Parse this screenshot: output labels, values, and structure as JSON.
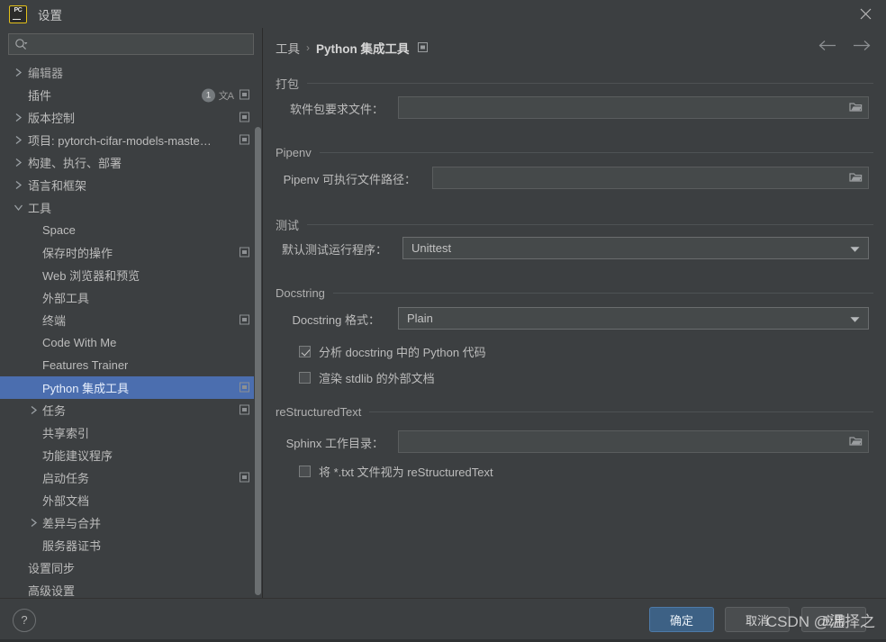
{
  "window": {
    "title": "设置",
    "logo_text": "PC",
    "close_label": "✕"
  },
  "search": {
    "value": "",
    "placeholder": ""
  },
  "sidebar": {
    "items": [
      {
        "label": "编辑器",
        "depth": 0,
        "arrow": "collapsed",
        "selected": false,
        "icons": []
      },
      {
        "label": "插件",
        "depth": 0,
        "arrow": "none",
        "selected": false,
        "icons": [
          "badge-1",
          "translate",
          "copy"
        ],
        "badge": "1"
      },
      {
        "label": "版本控制",
        "depth": 0,
        "arrow": "collapsed",
        "selected": false,
        "icons": [
          "copy"
        ]
      },
      {
        "label": "项目: pytorch-cifar-models-maste…",
        "depth": 0,
        "arrow": "collapsed",
        "selected": false,
        "icons": [
          "copy"
        ]
      },
      {
        "label": "构建、执行、部署",
        "depth": 0,
        "arrow": "collapsed",
        "selected": false,
        "icons": []
      },
      {
        "label": "语言和框架",
        "depth": 0,
        "arrow": "collapsed",
        "selected": false,
        "icons": []
      },
      {
        "label": "工具",
        "depth": 0,
        "arrow": "expanded",
        "selected": false,
        "icons": []
      },
      {
        "label": "Space",
        "depth": 1,
        "arrow": "none",
        "selected": false,
        "icons": []
      },
      {
        "label": "保存时的操作",
        "depth": 1,
        "arrow": "none",
        "selected": false,
        "icons": [
          "copy"
        ]
      },
      {
        "label": "Web 浏览器和预览",
        "depth": 1,
        "arrow": "none",
        "selected": false,
        "icons": []
      },
      {
        "label": "外部工具",
        "depth": 1,
        "arrow": "none",
        "selected": false,
        "icons": []
      },
      {
        "label": "终端",
        "depth": 1,
        "arrow": "none",
        "selected": false,
        "icons": [
          "copy"
        ]
      },
      {
        "label": "Code With Me",
        "depth": 1,
        "arrow": "none",
        "selected": false,
        "icons": []
      },
      {
        "label": "Features Trainer",
        "depth": 1,
        "arrow": "none",
        "selected": false,
        "icons": []
      },
      {
        "label": "Python 集成工具",
        "depth": 1,
        "arrow": "none",
        "selected": true,
        "icons": [
          "copy"
        ]
      },
      {
        "label": "任务",
        "depth": 1,
        "arrow": "collapsed",
        "selected": false,
        "icons": [
          "copy"
        ]
      },
      {
        "label": "共享索引",
        "depth": 1,
        "arrow": "none",
        "selected": false,
        "icons": []
      },
      {
        "label": "功能建议程序",
        "depth": 1,
        "arrow": "none",
        "selected": false,
        "icons": []
      },
      {
        "label": "启动任务",
        "depth": 1,
        "arrow": "none",
        "selected": false,
        "icons": [
          "copy"
        ]
      },
      {
        "label": "外部文档",
        "depth": 1,
        "arrow": "none",
        "selected": false,
        "icons": []
      },
      {
        "label": "差异与合并",
        "depth": 1,
        "arrow": "collapsed",
        "selected": false,
        "icons": []
      },
      {
        "label": "服务器证书",
        "depth": 1,
        "arrow": "none",
        "selected": false,
        "icons": []
      },
      {
        "label": "设置同步",
        "depth": 0,
        "arrow": "none",
        "selected": false,
        "icons": []
      },
      {
        "label": "高级设置",
        "depth": 0,
        "arrow": "none",
        "selected": false,
        "icons": []
      }
    ]
  },
  "breadcrumb": {
    "parent": "工具",
    "separator": "›",
    "current": "Python 集成工具"
  },
  "sections": {
    "packaging": {
      "title": "打包",
      "requirements_label": "软件包要求文件：",
      "requirements_value": ""
    },
    "pipenv": {
      "title": "Pipenv",
      "executable_label": "Pipenv 可执行文件路径：",
      "executable_value": ""
    },
    "testing": {
      "title": "测试",
      "default_runner_label": "默认测试运行程序：",
      "default_runner_value": "Unittest"
    },
    "docstring": {
      "title": "Docstring",
      "format_label": "Docstring 格式：",
      "format_value": "Plain",
      "analyze_label": "分析 docstring 中的 Python 代码",
      "analyze_checked": true,
      "render_stdlib_label": "渲染 stdlib 的外部文档",
      "render_stdlib_checked": false
    },
    "restructuredtext": {
      "title": "reStructuredText",
      "sphinx_label": "Sphinx 工作目录：",
      "sphinx_value": "",
      "treat_txt_label": "将 *.txt 文件视为 reStructuredText",
      "treat_txt_checked": false
    }
  },
  "footer": {
    "help_label": "?",
    "ok_label": "确定",
    "cancel_label": "取消",
    "apply_label": "应用"
  },
  "watermark": {
    "text": "CSDN @温择之"
  },
  "colors": {
    "window_bg": "#3c3f41",
    "selection": "#4b6eaf",
    "primary_button": "#3d6185",
    "field_bg": "#45494a",
    "text": "#bcbcbc"
  }
}
